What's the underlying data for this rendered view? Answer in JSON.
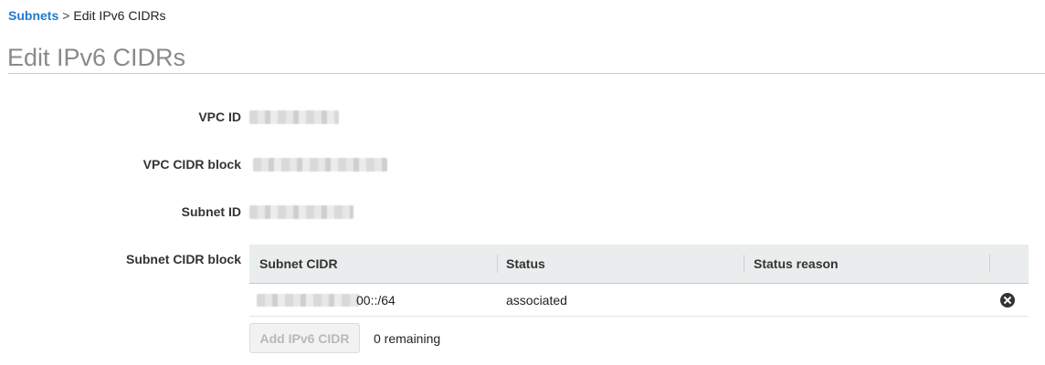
{
  "breadcrumb": {
    "parent": "Subnets",
    "separator": ">",
    "current": "Edit IPv6 CIDRs"
  },
  "page": {
    "title": "Edit IPv6 CIDRs"
  },
  "fields": {
    "vpc_id_label": "VPC ID",
    "vpc_cidr_label": "VPC CIDR block",
    "subnet_id_label": "Subnet ID",
    "subnet_cidr_label": "Subnet CIDR block"
  },
  "table": {
    "columns": [
      "Subnet CIDR",
      "Status",
      "Status reason"
    ],
    "rows": [
      {
        "cidr_suffix": "00::/64",
        "status": "associated",
        "status_reason": ""
      }
    ]
  },
  "actions": {
    "add_label": "Add IPv6 CIDR",
    "remaining": "0 remaining"
  },
  "colors": {
    "link": "#1f7ad0",
    "title": "#8a8a8a",
    "header_bg": "#eaeded"
  },
  "icons": {
    "remove": "close-circle-icon"
  }
}
